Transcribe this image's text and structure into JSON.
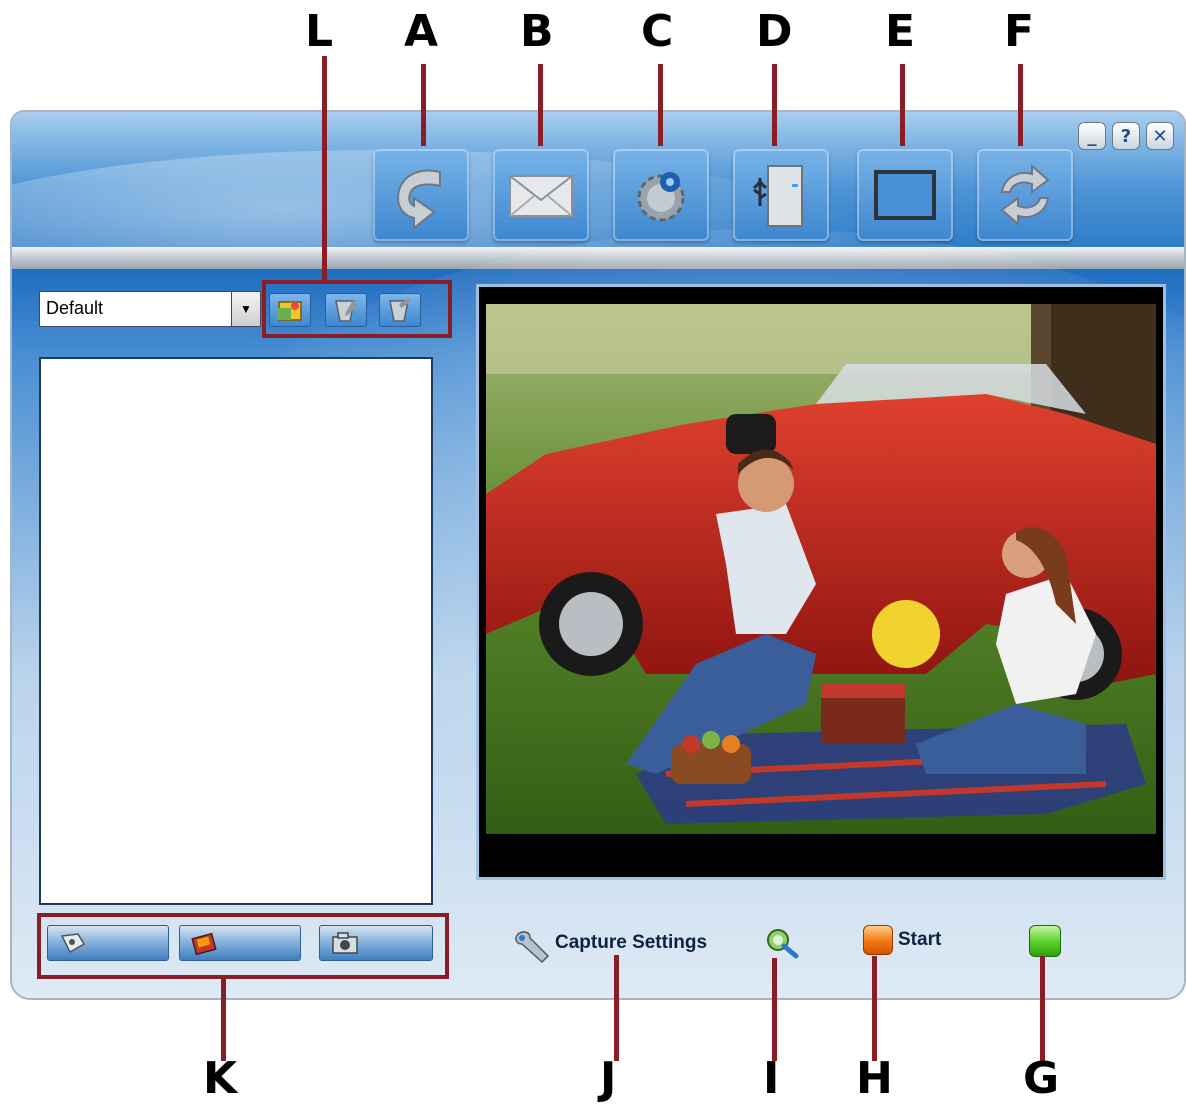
{
  "callouts": {
    "top": [
      "L",
      "A",
      "B",
      "C",
      "D",
      "E",
      "F"
    ],
    "bottom": [
      "K",
      "J",
      "I",
      "H",
      "G"
    ]
  },
  "toolbar": [
    {
      "name": "rotate",
      "icon": "rotate-arrow-icon"
    },
    {
      "name": "email",
      "icon": "envelope-icon"
    },
    {
      "name": "settings",
      "icon": "gear-icon"
    },
    {
      "name": "usb-device",
      "icon": "usb-computer-icon"
    },
    {
      "name": "display-mode",
      "icon": "window-frame-icon"
    },
    {
      "name": "refresh",
      "icon": "refresh-arrows-icon"
    }
  ],
  "window_controls": {
    "minimize": "_",
    "help": "?",
    "close": "✕"
  },
  "left_panel": {
    "profile_select": {
      "value": "Default",
      "arrow": "▼"
    },
    "profile_buttons": [
      "add-album-icon",
      "edit-album-icon",
      "delete-album-icon"
    ],
    "bottom_buttons": [
      "browse-icon",
      "photo-edit-icon",
      "camera-icon"
    ]
  },
  "preview": {
    "image": "photo-preview (couple picnicking beside a red convertible car)"
  },
  "controls": {
    "capture_settings_label": "Capture Settings",
    "start_label": "Start",
    "zoom_icon": "zoom-icon",
    "green_indicator": "green-status-icon"
  },
  "colors": {
    "accent": "#2f7cc8",
    "callout_line": "#8a1e26",
    "start": "#f27712",
    "green": "#54cf29"
  }
}
